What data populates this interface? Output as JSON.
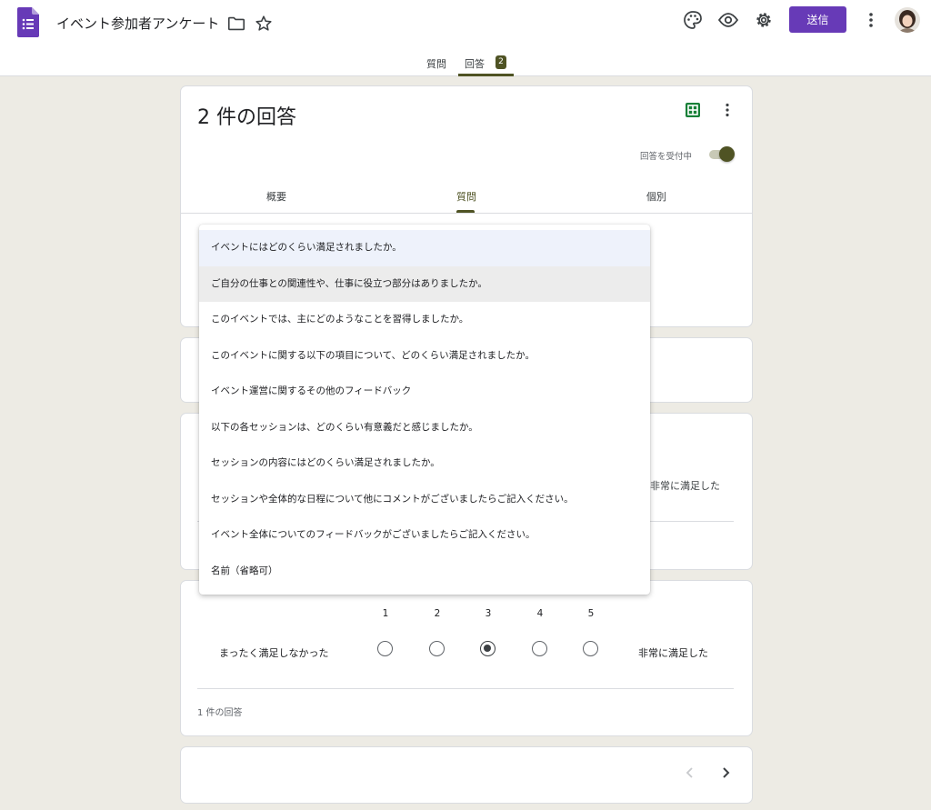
{
  "app": {
    "title": "イベント参加者アンケート",
    "send_label": "送信",
    "accent": "#673ab7",
    "theme": "#4f5324"
  },
  "main_tabs": [
    {
      "label": "質問",
      "active": false
    },
    {
      "label": "回答",
      "active": true,
      "badge": "2"
    }
  ],
  "summary": {
    "title": "2 件の回答",
    "accepting_label": "回答を受付中",
    "accepting": true,
    "sub_tabs": [
      {
        "label": "概要"
      },
      {
        "label": "質問",
        "active": true
      },
      {
        "label": "個別"
      }
    ]
  },
  "question_menu": {
    "items": [
      {
        "label": "イベントにはどのくらい満足されましたか。",
        "state": "selected"
      },
      {
        "label": "ご自分の仕事との関連性や、仕事に役立つ部分はありましたか。",
        "state": "hover"
      },
      {
        "label": "このイベントでは、主にどのようなことを習得しましたか。"
      },
      {
        "label": "このイベントに関する以下の項目について、どのくらい満足されましたか。"
      },
      {
        "label": "イベント運営に関するその他のフィードバック"
      },
      {
        "label": "以下の各セッションは、どのくらい有意義だと感じましたか。"
      },
      {
        "label": "セッションの内容にはどのくらい満足されましたか。"
      },
      {
        "label": "セッションや全体的な日程について他にコメントがございましたらご記入ください。"
      },
      {
        "label": "イベント全体についてのフィードバックがございましたらご記入ください。"
      },
      {
        "label": "名前（省略可）"
      }
    ]
  },
  "peek_card": {
    "high_label": "非常に満足した"
  },
  "scale_card": {
    "scale": [
      "1",
      "2",
      "3",
      "4",
      "5"
    ],
    "selected_value": "3",
    "low_label": "まったく満足しなかった",
    "high_label": "非常に満足した",
    "response_count": "1 件の回答"
  }
}
